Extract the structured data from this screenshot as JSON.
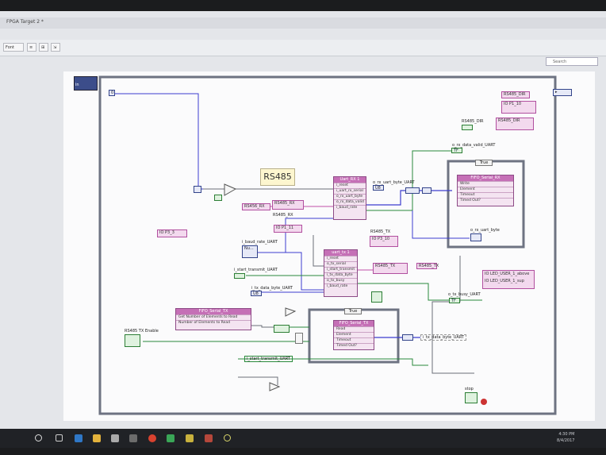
{
  "window": {
    "title": "FPGA Target 2 *"
  },
  "toolbar": {
    "font_label": "Font",
    "search_placeholder": "Search"
  },
  "diagram": {
    "title_label": "RS485",
    "left_control": "in",
    "right_terminal": "▸",
    "constant_top": "0",
    "labels": {
      "rs485_rx_ctrl": "RS456_RX",
      "rs485_rx_node": "RS485_RX",
      "rs485_rx_value": "RS485_RX",
      "io_p3_3": "IO P3_3",
      "baud_rate": "i_baud_rate_UART",
      "baud_rate_value": "Nu...",
      "start_transmit": "i_start_transmit_UART",
      "tx_data_byte": "i_tx_data_byte_UART",
      "tx_byte_value": "U8",
      "rs485_tx_label": "RS485_TX",
      "rs485_tx_node": "RS485_TX",
      "rs485_tx_ref": "RS485_TX",
      "io_p3_10": "IO P3_10",
      "rs485_dir_top": "RS485_DIR",
      "rs485_dir_label": "RS485_DIR",
      "io_p1_10": "IO P1_10",
      "rs485_dir_value": "RS485_DIR",
      "rx_data_valid": "o_rx_data_valid_UART",
      "rx_data_valid_val": "TF",
      "rx_uart_byte": "o_rx_uart_byte_UART",
      "rx_uart_byte_val": "U8",
      "rx_byte_out": "o_rx_uart_byte",
      "tx_busy": "o_tx_busy_UART",
      "tx_busy_val": "TF",
      "led_a": "IO LED_USER_1_above",
      "led_b": "IO LED_USER_1_sup",
      "rs485_tx_enable": "RS485 TX Enable",
      "start_transmit_out": "i_start_transmit_UART",
      "tx_data_byte_out": "i_tx_data_byte_UART",
      "stop": "stop"
    },
    "case_true": "True",
    "uart_rx": {
      "title": "Uart_RX 1",
      "rows": [
        "i_reset",
        "i_uart_rx_serial",
        "o_rx_uart_byte",
        "o_rx_data_valid",
        "i_baud_rate"
      ]
    },
    "uart_tx": {
      "title": "uart_tx 1",
      "rows": [
        "i_reset",
        "o_tx_serial",
        "i_start_transmit",
        "i_tx_data_byte",
        "o_tx_busy",
        "i_baud_rate"
      ]
    },
    "fifo_rx": {
      "title": "FIFO_Serial_RX",
      "rows": [
        "Write",
        "Element",
        "Timeout",
        "Timed Out?"
      ]
    },
    "fifo_tx_top": {
      "title": "FIFO_Serial_TX",
      "rows": [
        "Get Number of Elements to Read",
        "Number of Elements to Read"
      ]
    },
    "fifo_tx": {
      "title": "FIFO_Serial_TX",
      "rows": [
        "Read",
        "Element",
        "Timeout",
        "Timed Out?"
      ]
    }
  },
  "taskbar": {
    "time": "4:30 PM",
    "date": "8/4/2017"
  },
  "colors": {
    "wire_blue": "#3c3ccf",
    "wire_gray": "#6b6f78",
    "wire_pink": "#c24fa8",
    "wire_green": "#2a8a3b",
    "frame": "#6e7382"
  }
}
